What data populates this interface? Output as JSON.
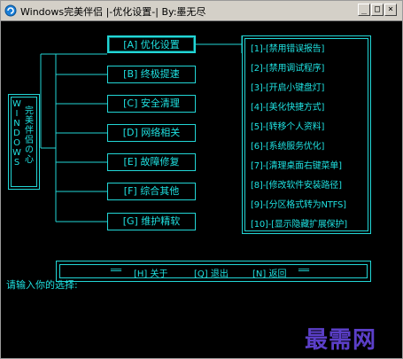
{
  "window": {
    "title": "Windows完美伴侣  |-优化设置-|          By:墨无尽",
    "minimize_glyph": "_",
    "maximize_glyph": "□",
    "close_glyph": "×"
  },
  "left_side": {
    "vertical_letters": "W\nI\nN\nD\nO\nW\nS",
    "vertical_cn": "完\n美\n伴\n侣\nの\n心"
  },
  "menu": [
    {
      "label": "[A] 优化设置"
    },
    {
      "label": "[B] 终极提速"
    },
    {
      "label": "[C] 安全清理"
    },
    {
      "label": "[D] 网络相关"
    },
    {
      "label": "[E] 故障修复"
    },
    {
      "label": "[F] 综合其他"
    },
    {
      "label": "[G] 维护精软"
    }
  ],
  "options": [
    {
      "label": "[1]-[禁用错误报告]"
    },
    {
      "label": "[2]-[禁用调试程序]"
    },
    {
      "label": "[3]-[开启小键盘灯]"
    },
    {
      "label": "[4]-[美化快捷方式]"
    },
    {
      "label": "[5]-[转移个人资料]"
    },
    {
      "label": "[6]-[系统服务优化]"
    },
    {
      "label": "[7]-[清理桌面右键菜单]"
    },
    {
      "label": "[8]-[修改软件安装路径]"
    },
    {
      "label": "[9]-[分区格式转为NTFS]"
    },
    {
      "label": "[10]-[显示隐藏扩展保护]"
    }
  ],
  "bottom_bar": {
    "left_deco": "══",
    "about": "[H] 关于",
    "quit": "[Q] 退出",
    "back": "[N] 返回",
    "right_deco": "══"
  },
  "prompt": "请输入你的选择:",
  "brand": "最需网",
  "colors": {
    "accent": "#1fe0e0",
    "background": "#000000",
    "brand": "#5b3fc8"
  }
}
